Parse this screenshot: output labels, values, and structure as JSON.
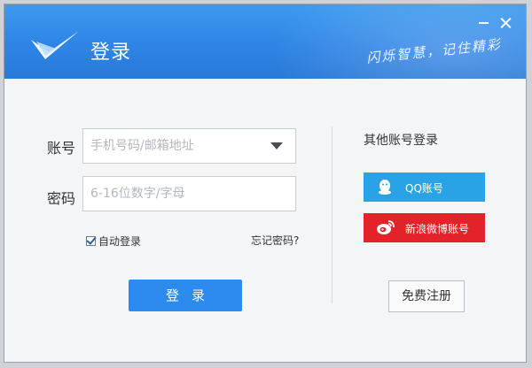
{
  "window": {
    "title": "登录",
    "slogan": "闪烁智慧，记住精彩",
    "accent_color": "#2d8bf0"
  },
  "form": {
    "account_label": "账号",
    "account_placeholder": "手机号码/邮箱地址",
    "password_label": "密码",
    "password_placeholder": "6-16位数字/字母",
    "auto_login_label": "自动登录",
    "auto_login_checked": true,
    "forgot_password": "忘记密码?",
    "login_button": "登录"
  },
  "other_login": {
    "title": "其他账号登录",
    "qq_label": "QQ账号",
    "weibo_label": "新浪微博账号",
    "qq_color": "#29a3e6",
    "weibo_color": "#e4222a"
  },
  "register_button": "免费注册",
  "icons": {
    "logo": "check-logo-icon",
    "minimize": "minimize-icon",
    "close": "close-icon",
    "dropdown": "chevron-down-icon",
    "qq": "qq-penguin-icon",
    "weibo": "weibo-icon"
  }
}
